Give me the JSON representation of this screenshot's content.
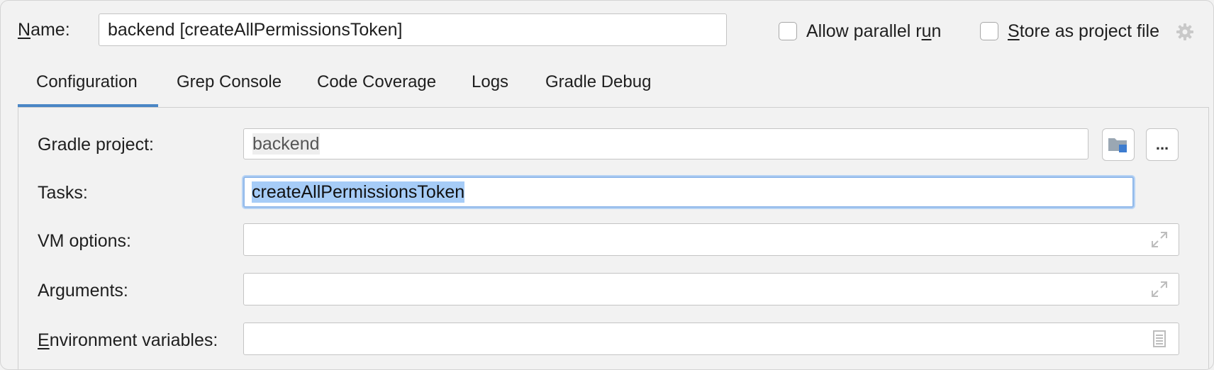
{
  "header": {
    "name_label": "Name:",
    "name_value": "backend [createAllPermissionsToken]",
    "allow_parallel_label": "Allow parallel run",
    "store_project_label": "Store as project file"
  },
  "tabs": [
    {
      "label": "Configuration",
      "active": true
    },
    {
      "label": "Grep Console",
      "active": false
    },
    {
      "label": "Code Coverage",
      "active": false
    },
    {
      "label": "Logs",
      "active": false
    },
    {
      "label": "Gradle Debug",
      "active": false
    }
  ],
  "form": {
    "gradle_project_label": "Gradle project:",
    "gradle_project_value": "backend",
    "browse_button_label": "...",
    "tasks_label": "Tasks:",
    "tasks_value": "createAllPermissionsToken",
    "vm_options_label": "VM options:",
    "vm_options_value": "",
    "arguments_label": "Arguments:",
    "arguments_value": "",
    "env_vars_label": "Environment variables:",
    "env_vars_value": ""
  },
  "icons": {
    "gear": "gear-icon",
    "folder": "folder-icon",
    "expand": "expand-icon",
    "document": "document-icon"
  },
  "colors": {
    "accent": "#4a86c5",
    "selection": "#a6ccf7",
    "focus_ring": "#90b8ea"
  }
}
